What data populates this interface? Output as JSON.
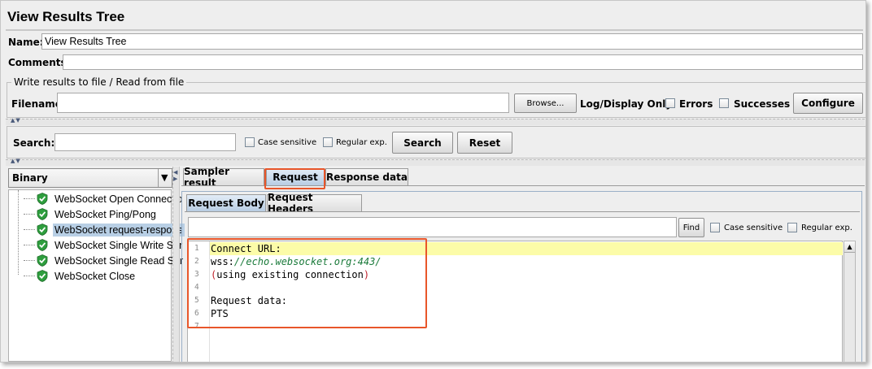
{
  "title": "View Results Tree",
  "name": {
    "label": "Name:",
    "value": "View Results Tree"
  },
  "comments": {
    "label": "Comments:",
    "value": ""
  },
  "write_results": {
    "legend": "Write results to file / Read from file",
    "filename_label": "Filename",
    "browse_label": "Browse...",
    "log_display_label": "Log/Display Only:",
    "errors_label": "Errors",
    "successes_label": "Successes",
    "configure_label": "Configure"
  },
  "search": {
    "label": "Search:",
    "case_sensitive": "Case sensitive",
    "regular_exp": "Regular exp.",
    "search_label": "Search",
    "reset_label": "Reset"
  },
  "renderer": {
    "selected": "Binary"
  },
  "tree": {
    "selected_index": 2,
    "items": [
      {
        "label": "WebSocket Open Connectio",
        "status_icon": "green-shield-check-icon"
      },
      {
        "label": "WebSocket Ping/Pong",
        "status_icon": "green-shield-check-icon"
      },
      {
        "label": "WebSocket request-respons",
        "status_icon": "green-shield-check-icon"
      },
      {
        "label": "WebSocket Single Write Sar",
        "status_icon": "green-shield-check-icon"
      },
      {
        "label": "WebSocket Single Read Sar",
        "status_icon": "green-shield-check-icon"
      },
      {
        "label": "WebSocket Close",
        "status_icon": "green-shield-check-icon"
      }
    ]
  },
  "tabs": [
    "Sampler result",
    "Request",
    "Response data"
  ],
  "active_tab": "Request",
  "subtabs": [
    "Request Body",
    "Request Headers"
  ],
  "active_subtab": "Request Body",
  "find": {
    "button_label": "Find",
    "case_sensitive": "Case sensitive",
    "regular_exp": "Regular exp."
  },
  "editor": {
    "lines": [
      {
        "num": "1",
        "parts": [
          {
            "text": "Connect URL:",
            "style": "plain"
          }
        ]
      },
      {
        "num": "2",
        "parts": [
          {
            "text": "wss:",
            "style": "plain"
          },
          {
            "text": "//echo.websocket.org:443/",
            "style": "url"
          }
        ]
      },
      {
        "num": "3",
        "parts": [
          {
            "text": "(",
            "style": "paren"
          },
          {
            "text": "using existing connection",
            "style": "plain"
          },
          {
            "text": ")",
            "style": "paren"
          }
        ]
      },
      {
        "num": "4",
        "parts": []
      },
      {
        "num": "5",
        "parts": [
          {
            "text": "Request data:",
            "style": "plain"
          }
        ]
      },
      {
        "num": "6",
        "parts": [
          {
            "text": "PTS",
            "style": "plain"
          }
        ]
      },
      {
        "num": "7",
        "parts": []
      }
    ]
  },
  "colors": {
    "highlight_border": "#e8562a",
    "url_text": "#1a7a3a",
    "paren_text": "#c0202a",
    "current_line": "#fcfca8",
    "selection": "#b8cfe5",
    "status_green": "#2e9e3e"
  }
}
